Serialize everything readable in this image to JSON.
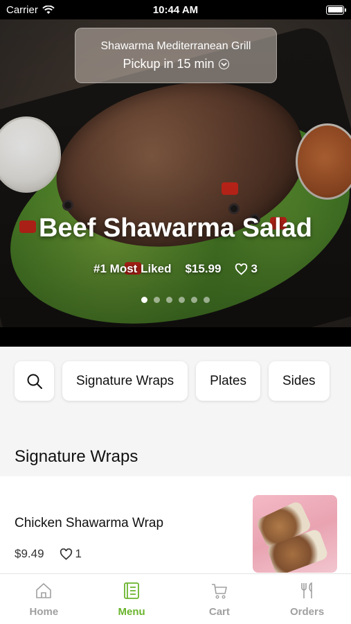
{
  "status_bar": {
    "carrier": "Carrier",
    "time": "10:44 AM"
  },
  "hero": {
    "store_name": "Shawarma Mediterranean Grill",
    "pickup": "Pickup in 15 min",
    "title": "Beef Shawarma Salad",
    "badge": "#1 Most Liked",
    "price": "$15.99",
    "likes": "3",
    "carousel": {
      "count": 6,
      "active_index": 0
    }
  },
  "categories": [
    "Signature Wraps",
    "Plates",
    "Sides"
  ],
  "section": {
    "title": "Signature Wraps"
  },
  "item": {
    "name": "Chicken Shawarma Wrap",
    "price": "$9.49",
    "likes": "1"
  },
  "tabs": [
    {
      "label": "Home",
      "icon": "home-icon",
      "active": false
    },
    {
      "label": "Menu",
      "icon": "menu-icon",
      "active": true
    },
    {
      "label": "Cart",
      "icon": "cart-icon",
      "active": false
    },
    {
      "label": "Orders",
      "icon": "fork-knife-icon",
      "active": false
    }
  ],
  "colors": {
    "accent": "#6ab42c",
    "inactive": "#a0a0a0"
  }
}
